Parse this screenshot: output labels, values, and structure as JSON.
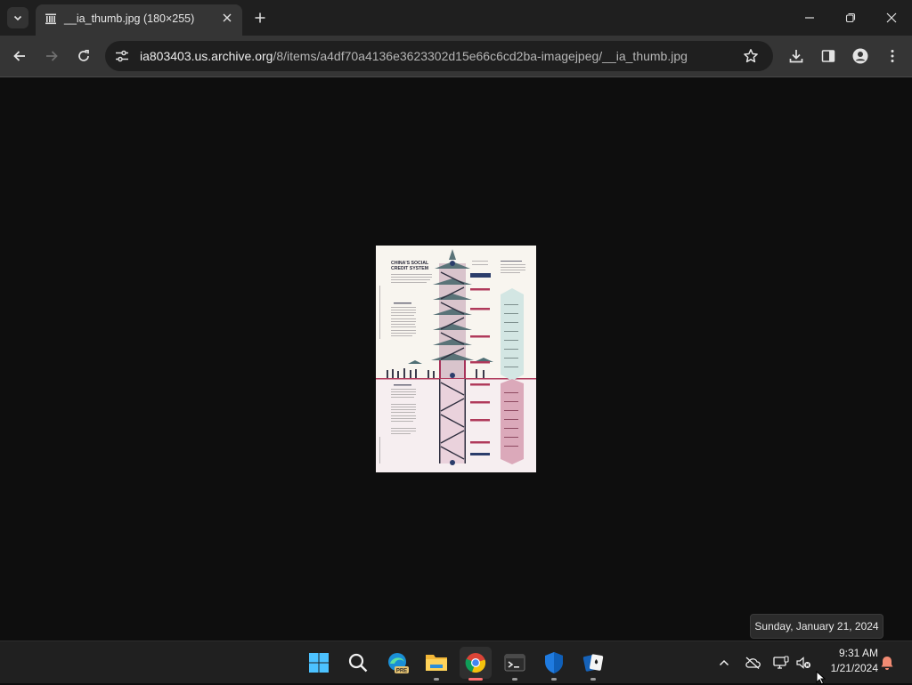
{
  "browser": {
    "tab_title": "__ia_thumb.jpg (180×255)",
    "url_host": "ia803403.us.archive.org",
    "url_path": "/8/items/a4df70a4136e3623302d15e66c6cd2ba-imagejpeg/__ia_thumb.jpg"
  },
  "image": {
    "heading": "CHINA'S SOCIAL CREDIT SYSTEM"
  },
  "taskbar": {
    "apps": [
      "start-icon",
      "search-icon",
      "edge-beta-icon",
      "file-explorer-icon",
      "chrome-icon",
      "terminal-icon",
      "defender-icon",
      "solitaire-icon"
    ],
    "edge_badge": "PRE"
  },
  "clock": {
    "time": "9:31 AM",
    "date": "1/21/2024"
  },
  "tooltip": {
    "text": "Sunday, January 21, 2024"
  }
}
